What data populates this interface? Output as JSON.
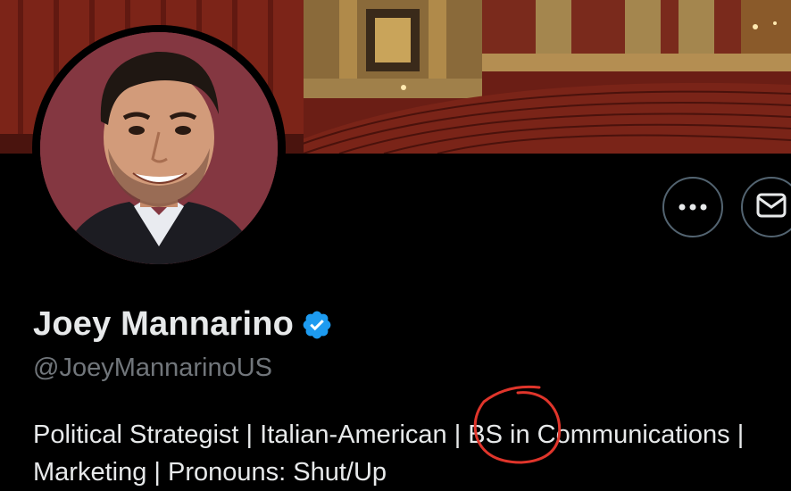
{
  "profile": {
    "display_name": "Joey Mannarino",
    "handle": "@JoeyMannarinoUS",
    "bio_line_1": "Political Strategist | Italian-American | BS in Communications |",
    "bio_line_2": "Marketing | Pronouns: Shut/Up"
  },
  "icons": {
    "more": "more-horizontal-icon",
    "message": "envelope-icon",
    "verified": "verified-badge-icon"
  },
  "colors": {
    "background": "#000000",
    "text_primary": "#e7e9ea",
    "text_secondary": "#71767b",
    "button_border": "#536471",
    "verified_blue": "#1d9bf0",
    "annotation_red": "#e0352b"
  }
}
